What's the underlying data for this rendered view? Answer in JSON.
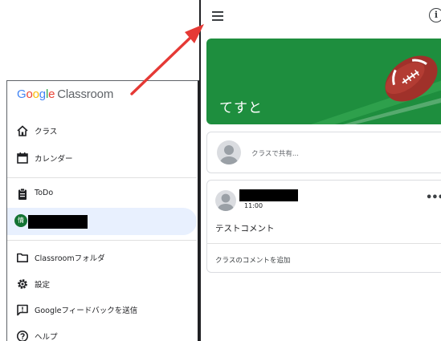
{
  "drawer": {
    "logo_google": "Google",
    "logo_product": "Classroom",
    "logo_colors": [
      "#4285F4",
      "#EA4335",
      "#FBBC05",
      "#4285F4",
      "#34A853",
      "#EA4335"
    ],
    "items": [
      {
        "label": "クラス",
        "icon": "home-icon"
      },
      {
        "label": "カレンダー",
        "icon": "calendar-icon"
      },
      {
        "label": "ToDo",
        "icon": "todo-clipboard-icon"
      },
      {
        "label": "",
        "icon": "class-avatar",
        "avatar_letter": "情",
        "redacted": true
      },
      {
        "label": "Classroomフォルダ",
        "icon": "folder-icon"
      },
      {
        "label": "設定",
        "icon": "settings-gear-icon"
      },
      {
        "label": "Googleフィードバックを送信",
        "icon": "feedback-icon"
      },
      {
        "label": "ヘルプ",
        "icon": "help-icon"
      }
    ]
  },
  "stream": {
    "menu_icon": "hamburger-menu-icon",
    "info_icon": "info-icon",
    "info_glyph": "i",
    "banner_title": "てすと",
    "banner_color": "#1e8e3e",
    "share_placeholder": "クラスで共有...",
    "post": {
      "time": "11:00",
      "more_glyph": "•••",
      "body": "テストコメント",
      "add_comment": "クラスのコメントを追加"
    }
  },
  "annotation_color": "#e53935"
}
